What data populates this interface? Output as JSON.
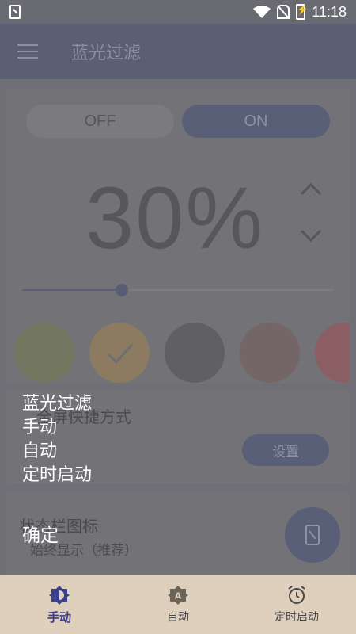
{
  "status_bar": {
    "time": "11:18"
  },
  "app_bar": {
    "title": "蓝光过滤"
  },
  "filter_toggle": {
    "off_label": "OFF",
    "on_label": "ON",
    "selected": "on"
  },
  "intensity": {
    "display": "30%",
    "value_percent": 30
  },
  "slider": {
    "value_fraction": 0.32
  },
  "color_swatches": [
    {
      "color": "#73775f",
      "selected": false
    },
    {
      "color": "#8c7b60",
      "selected": true
    },
    {
      "color": "#606064",
      "selected": false
    },
    {
      "color": "#746566",
      "selected": false
    },
    {
      "color": "#8a5e63",
      "selected": false
    }
  ],
  "shortcut_card": {
    "title": "全屏快捷方式",
    "button_label": "设置"
  },
  "statusbar_icon_card": {
    "title": "状态栏图标",
    "subtitle": "始终显示（推荐）"
  },
  "overlay_menu": {
    "items": [
      "蓝光过滤",
      "手动",
      "自动",
      "定时启动"
    ],
    "confirm": "确定"
  },
  "bottom_nav": {
    "items": [
      {
        "label": "手动",
        "icon": "manual-mode-icon",
        "active": true
      },
      {
        "label": "自动",
        "icon": "auto-mode-icon",
        "active": false
      },
      {
        "label": "定时启动",
        "icon": "alarm-clock-icon",
        "active": false
      }
    ]
  },
  "colors": {
    "accent": "#3b3e8a",
    "nav_background": "#ded0bd"
  }
}
